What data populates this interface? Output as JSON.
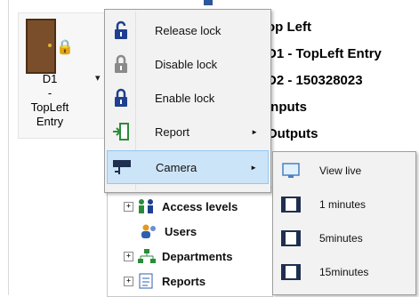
{
  "door_tile": {
    "name": "D1",
    "sep": "-",
    "location": "TopLeft",
    "type": "Entry",
    "dropdown": "▾"
  },
  "info_panel": {
    "title": "op Left",
    "line1": "D1 - TopLeft Entry",
    "line2": "D2 - 150328023",
    "line3": "Inputs",
    "line4": "Outputs"
  },
  "context_menu": {
    "items": [
      {
        "label": "Release lock",
        "icon": "unlock-icon"
      },
      {
        "label": "Disable lock",
        "icon": "lock-disabled-icon"
      },
      {
        "label": "Enable lock",
        "icon": "lock-icon"
      },
      {
        "label": "Report",
        "icon": "door-report-icon",
        "arrow": "►"
      },
      {
        "label": "Camera",
        "icon": "camera-icon",
        "arrow": "►"
      }
    ]
  },
  "camera_submenu": {
    "items": [
      {
        "label": "View live",
        "icon": "monitor-icon"
      },
      {
        "label": "1 minutes",
        "icon": "film-icon"
      },
      {
        "label": "5minutes",
        "icon": "film-icon"
      },
      {
        "label": "15minutes",
        "icon": "film-icon"
      }
    ]
  },
  "tree": {
    "items": [
      {
        "label": "Access levels",
        "icon": "people-icon",
        "expander": "+"
      },
      {
        "label": "Users",
        "icon": "users-icon"
      },
      {
        "label": "Departments",
        "icon": "departments-icon",
        "expander": "+"
      },
      {
        "label": "Reports",
        "icon": "reports-icon",
        "expander": "+"
      }
    ]
  },
  "colors": {
    "highlight": "#cce4f7",
    "highlight_border": "#90c8f6",
    "menu_bg": "#f2f2f2",
    "door_wood": "#7a4e2a"
  }
}
